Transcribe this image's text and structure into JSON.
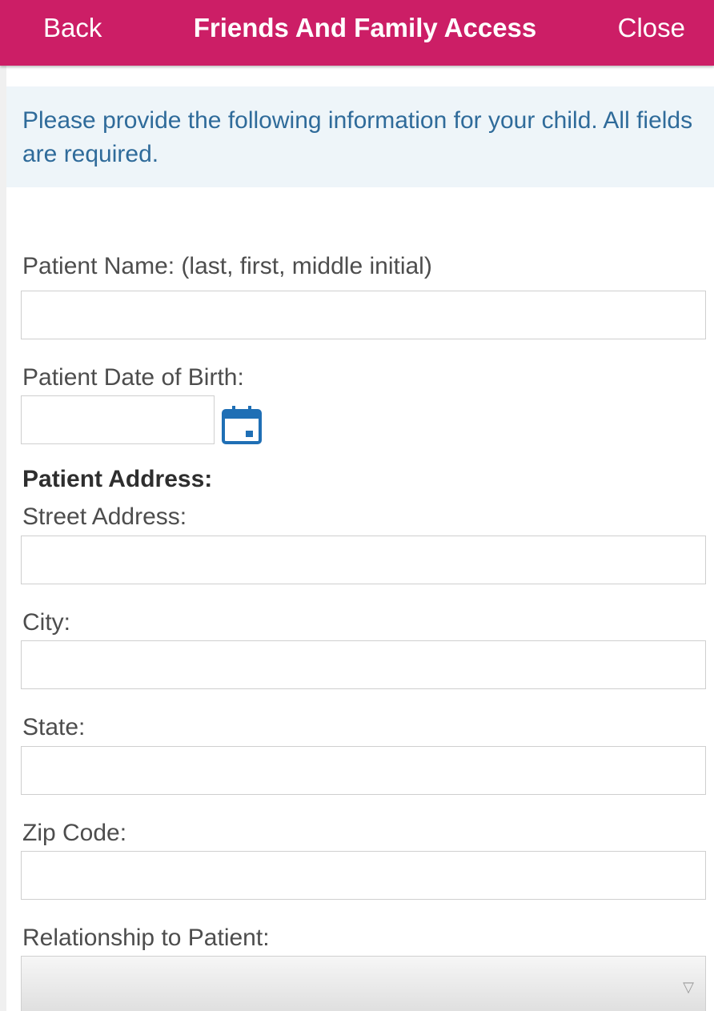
{
  "header": {
    "back_label": "Back",
    "title": "Friends And Family Access",
    "close_label": "Close"
  },
  "notice": {
    "text": "Please provide the following information for your child. All fields are required."
  },
  "form": {
    "patient_name_label": "Patient Name: (last, first, middle initial)",
    "patient_name_value": "",
    "dob_label": "Patient Date of Birth:",
    "dob_value": "",
    "address_heading": "Patient Address:",
    "street_label": "Street Address:",
    "street_value": "",
    "city_label": "City:",
    "city_value": "",
    "state_label": "State:",
    "state_value": "",
    "zip_label": "Zip Code:",
    "zip_value": "",
    "relationship_label": "Relationship to Patient:",
    "relationship_value": "",
    "calendar_icon": "calendar-icon",
    "dropdown_icon": "chevron-down-icon"
  },
  "colors": {
    "header_bg": "#cc1e66",
    "notice_bg": "#eef5f9",
    "notice_text": "#2f6b9a",
    "icon_blue": "#1f6fb5"
  }
}
